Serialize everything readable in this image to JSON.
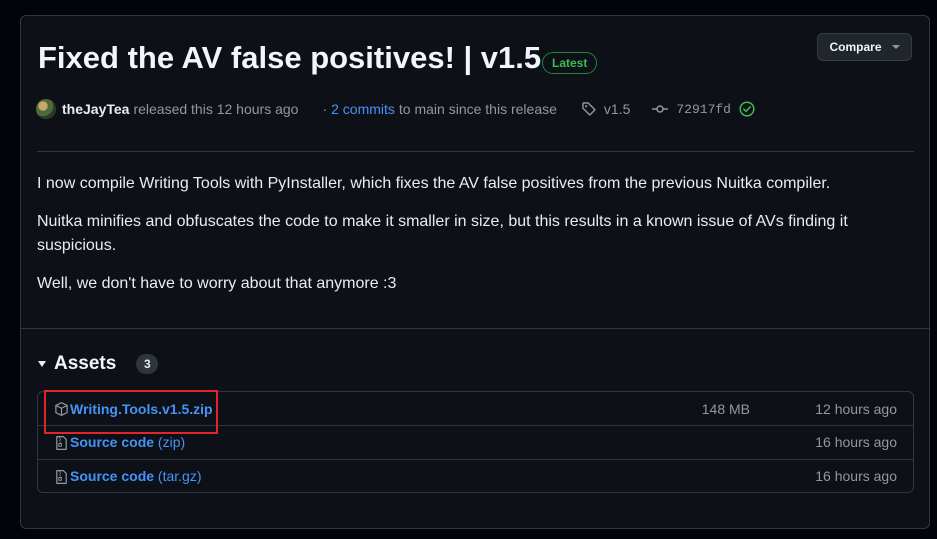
{
  "release": {
    "title": "Fixed the AV false positives! | v1.5",
    "badge": "Latest",
    "compare_label": "Compare",
    "author": "theJayTea",
    "released_text": "released this 12 hours ago",
    "commits_prefix": "·",
    "commits_link": "2 commits",
    "commits_suffix": "to main since this release",
    "tag": "v1.5",
    "commit_hash": "72917fd"
  },
  "body": {
    "paragraphs": [
      "I now compile Writing Tools with PyInstaller, which fixes the AV false positives from the previous Nuitka compiler.",
      "Nuitka minifies and obfuscates the code to make it smaller in size, but this results in a known issue of AVs finding it suspicious.",
      "Well, we don't have to worry about that anymore :3"
    ]
  },
  "assets": {
    "title": "Assets",
    "count": "3",
    "items": [
      {
        "name": "Writing.Tools.v1.5.zip",
        "suffix": "",
        "size": "148 MB",
        "date": "12 hours ago",
        "icon": "package-icon"
      },
      {
        "name": "Source code",
        "suffix": "(zip)",
        "size": "",
        "date": "16 hours ago",
        "icon": "file-zip-icon"
      },
      {
        "name": "Source code",
        "suffix": "(tar.gz)",
        "size": "",
        "date": "16 hours ago",
        "icon": "file-zip-icon"
      }
    ]
  },
  "colors": {
    "link": "#4493f8",
    "success": "#3fb950",
    "highlight": "#e0252b",
    "background": "#0d1117"
  }
}
